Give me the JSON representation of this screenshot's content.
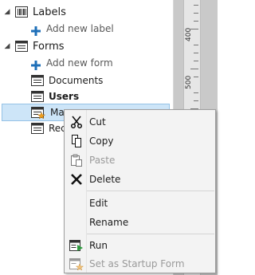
{
  "tree": {
    "labels_group": "Labels",
    "add_label": "Add new label",
    "forms_group": "Forms",
    "add_form": "Add new form",
    "items": [
      "Documents",
      "Users",
      "Ma",
      "Rec"
    ]
  },
  "ruler": {
    "marks": [
      "400",
      "500"
    ]
  },
  "context_menu": {
    "cut": "Cut",
    "copy": "Copy",
    "paste": "Paste",
    "delete": "Delete",
    "edit": "Edit",
    "rename": "Rename",
    "run": "Run",
    "startup": "Set as Startup Form"
  },
  "colors": {
    "selection": "#cde5f8",
    "accent_blue": "#1e6fb8"
  }
}
